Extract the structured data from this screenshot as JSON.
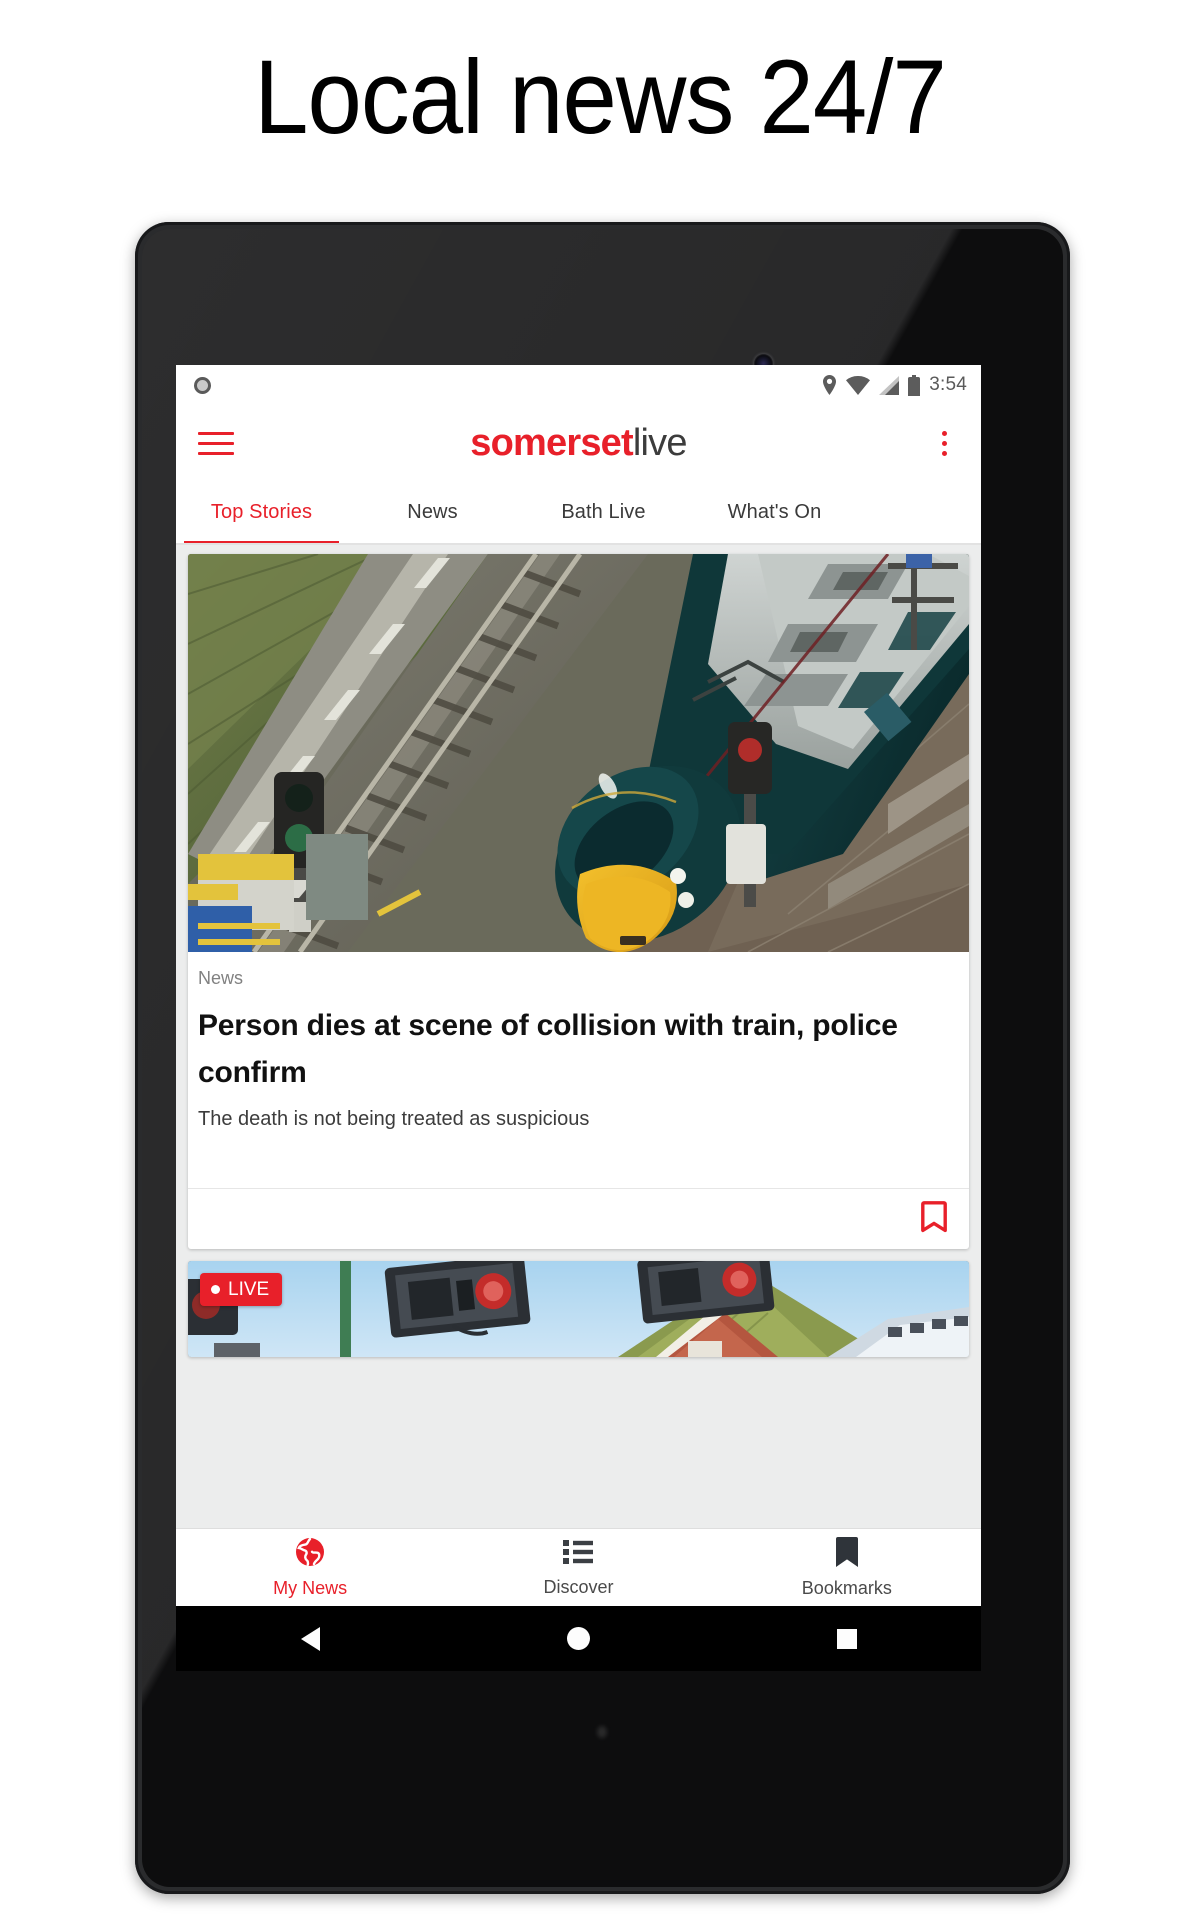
{
  "promo": {
    "headline": "Local news 24/7"
  },
  "status_bar": {
    "notification_icon": "circle-notification-icon",
    "icons": [
      "location-pin-icon",
      "wifi-icon",
      "cell-signal-icon",
      "battery-full-icon"
    ],
    "time": "3:54"
  },
  "app_bar": {
    "menu_icon": "hamburger-menu-icon",
    "brand_bold": "somerset",
    "brand_light": "live",
    "overflow_icon": "overflow-menu-icon"
  },
  "tabs": {
    "items": [
      {
        "label": "Top Stories",
        "active": true
      },
      {
        "label": "News",
        "active": false
      },
      {
        "label": "Bath Live",
        "active": false
      },
      {
        "label": "What's On",
        "active": false
      }
    ]
  },
  "feed": {
    "cards": [
      {
        "photo_alt": "aerial view of dark green GWR intercity train with yellow nose on railway tracks beside a grassy embankment",
        "kicker": "News",
        "headline": "Person dies at scene of collision with train, police confirm",
        "summary": "The death is not being treated as suspicious",
        "bookmark_icon": "bookmark-outline-icon"
      },
      {
        "photo_alt": "level crossing signals against blue sky with red-roofed house",
        "badge": "LIVE"
      }
    ]
  },
  "bottom_nav": {
    "items": [
      {
        "label": "My News",
        "icon": "globe-icon",
        "active": true
      },
      {
        "label": "Discover",
        "icon": "list-icon",
        "active": false
      },
      {
        "label": "Bookmarks",
        "icon": "bookmark-filled-icon",
        "active": false
      }
    ]
  },
  "android_nav": {
    "back": "back-triangle-icon",
    "home": "home-circle-icon",
    "recents": "recents-square-icon"
  },
  "colors": {
    "brand_red": "#e8202a",
    "feed_background": "#eceded",
    "text_dark": "#111111"
  }
}
